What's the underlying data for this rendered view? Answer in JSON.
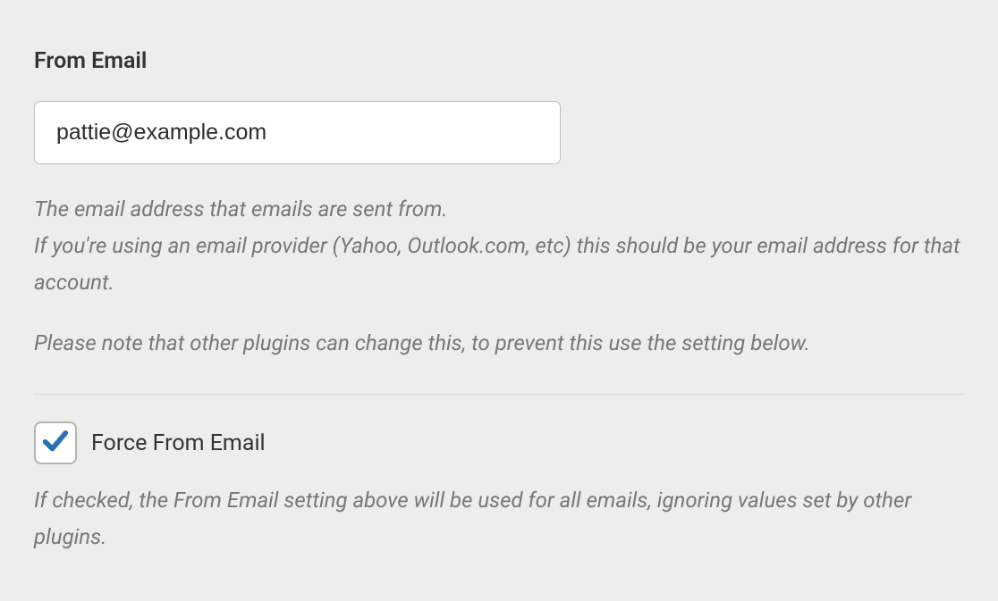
{
  "section": {
    "title": "From Email",
    "email_value": "pattie@example.com",
    "help_line1": "The email address that emails are sent from.",
    "help_line2": "If you're using an email provider (Yahoo, Outlook.com, etc) this should be your email address for that account.",
    "help_line3": "Please note that other plugins can change this, to prevent this use the setting below."
  },
  "checkbox": {
    "checked": true,
    "label": "Force From Email",
    "help": "If checked, the From Email setting above will be used for all emails, ignoring values set by other plugins."
  }
}
